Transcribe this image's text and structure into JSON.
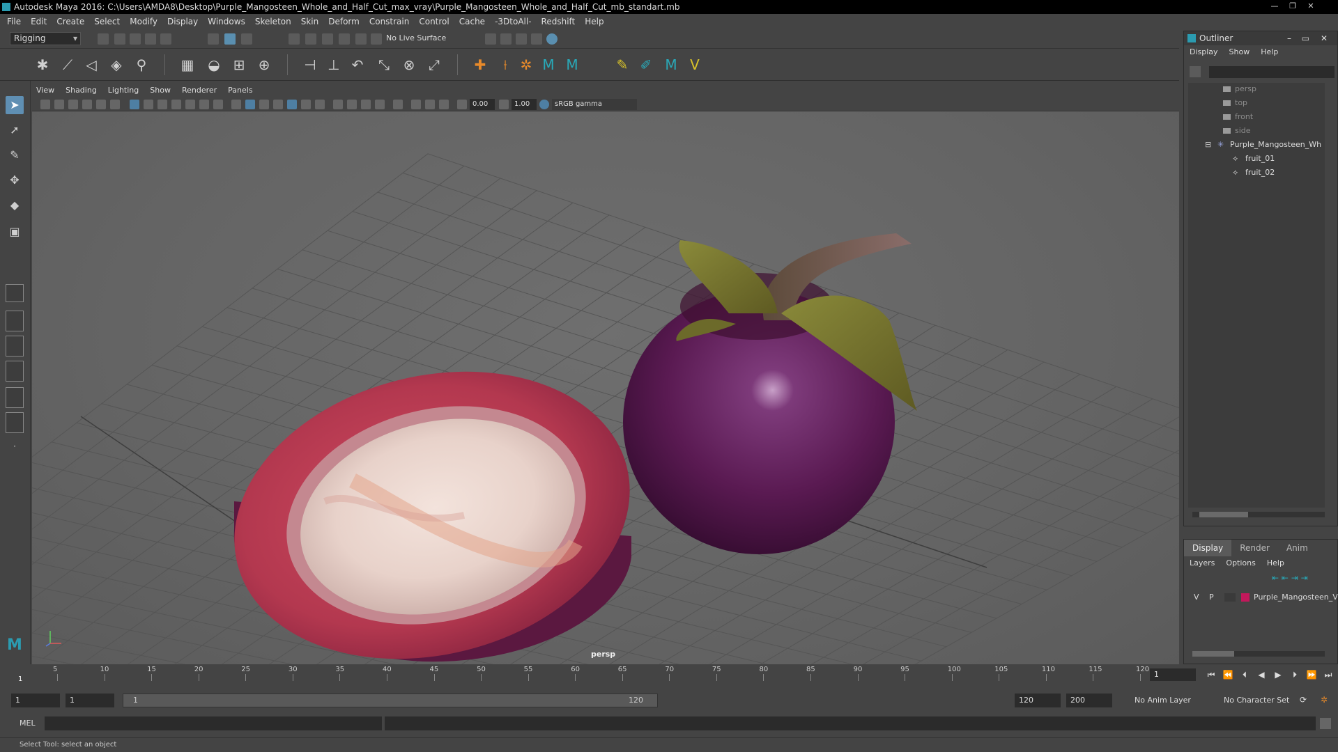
{
  "window": {
    "title": "Autodesk Maya 2016: C:\\Users\\AMDA8\\Desktop\\Purple_Mangosteen_Whole_and_Half_Cut_max_vray\\Purple_Mangosteen_Whole_and_Half_Cut_mb_standart.mb",
    "controls": [
      "—",
      "❐",
      "✕"
    ]
  },
  "menubar": [
    "File",
    "Edit",
    "Create",
    "Select",
    "Modify",
    "Display",
    "Windows",
    "Skeleton",
    "Skin",
    "Deform",
    "Constrain",
    "Control",
    "Cache",
    "-3DtoAll-",
    "Redshift",
    "Help"
  ],
  "statusline": {
    "mode": "Rigging",
    "live_surface": "No Live Surface"
  },
  "panel": {
    "menu": [
      "View",
      "Shading",
      "Lighting",
      "Show",
      "Renderer",
      "Panels"
    ],
    "exposure": "0.00",
    "gamma": "1.00",
    "color_space": "sRGB gamma",
    "camera": "persp"
  },
  "outliner": {
    "title": "Outliner",
    "menu": [
      "Display",
      "Show",
      "Help"
    ],
    "items": [
      {
        "label": "persp",
        "type": "camera"
      },
      {
        "label": "top",
        "type": "camera"
      },
      {
        "label": "front",
        "type": "camera"
      },
      {
        "label": "side",
        "type": "camera"
      },
      {
        "label": "Purple_Mangosteen_Wh",
        "type": "group"
      },
      {
        "label": "fruit_01",
        "type": "mesh"
      },
      {
        "label": "fruit_02",
        "type": "mesh"
      }
    ]
  },
  "layers": {
    "tabs": [
      "Display",
      "Render",
      "Anim"
    ],
    "menu": [
      "Layers",
      "Options",
      "Help"
    ],
    "row": {
      "v": "V",
      "p": "P",
      "name": "Purple_Mangosteen_V",
      "color": "#c2185b"
    }
  },
  "timeline": {
    "ticks": [
      "5",
      "10",
      "15",
      "20",
      "25",
      "30",
      "35",
      "40",
      "45",
      "50",
      "55",
      "60",
      "65",
      "70",
      "75",
      "80",
      "85",
      "90",
      "95",
      "100",
      "105",
      "110",
      "115",
      "120"
    ],
    "start_label": "1",
    "current_frame": "1"
  },
  "range": {
    "start": "1",
    "playback_start": "1",
    "bar_start": "1",
    "bar_end": "120",
    "playback_end": "120",
    "end": "200",
    "anim_layer": "No Anim Layer",
    "character_set": "No Character Set"
  },
  "cmdline": {
    "label": "MEL"
  },
  "helpline": {
    "text": "Select Tool: select an object"
  }
}
